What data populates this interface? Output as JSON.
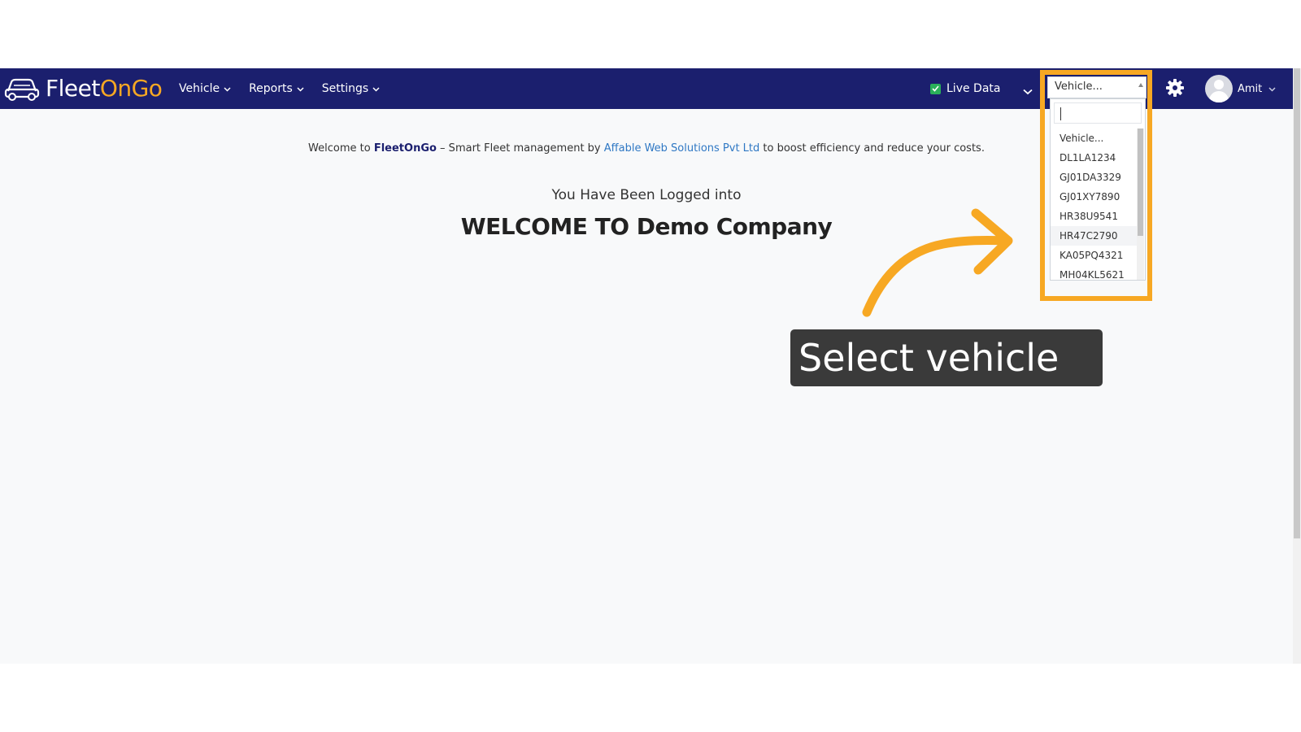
{
  "app": {
    "brand_part1": "Fleet",
    "brand_part2": "OnGo"
  },
  "nav": {
    "items": [
      {
        "label": "Vehicle"
      },
      {
        "label": "Reports"
      },
      {
        "label": "Settings"
      }
    ],
    "live_data_label": "Live Data",
    "vehicle_select_value": "Vehicle...",
    "user_name": "Amit"
  },
  "main": {
    "welcome_prefix": "Welcome to",
    "welcome_brand": "FleetOnGo",
    "welcome_middle": " – Smart Fleet management by ",
    "welcome_company": "Affable Web Solutions Pvt Ltd",
    "welcome_suffix": " to boost efficiency and reduce your costs.",
    "logged_in_text": "You Have Been Logged into",
    "company_title": "WELCOME TO Demo Company"
  },
  "vehicle_dropdown": {
    "search_value": "",
    "options": [
      "Vehicle...",
      "DL1LA1234",
      "GJ01DA3329",
      "GJ01XY7890",
      "HR38U9541",
      "HR47C2790",
      "KA05PQ4321",
      "MH04KL5621"
    ]
  },
  "annotation": {
    "callout_text": "Select vehicle",
    "accent_color": "#f7a823"
  },
  "colors": {
    "navbar": "#1b1f6e",
    "brand_accent": "#f7a823",
    "link": "#2f78c4",
    "check": "#2ab05a"
  },
  "icons": [
    "car-logo-icon",
    "chevron-down-icon",
    "checkbox-checked-icon",
    "gear-icon",
    "avatar-icon"
  ]
}
